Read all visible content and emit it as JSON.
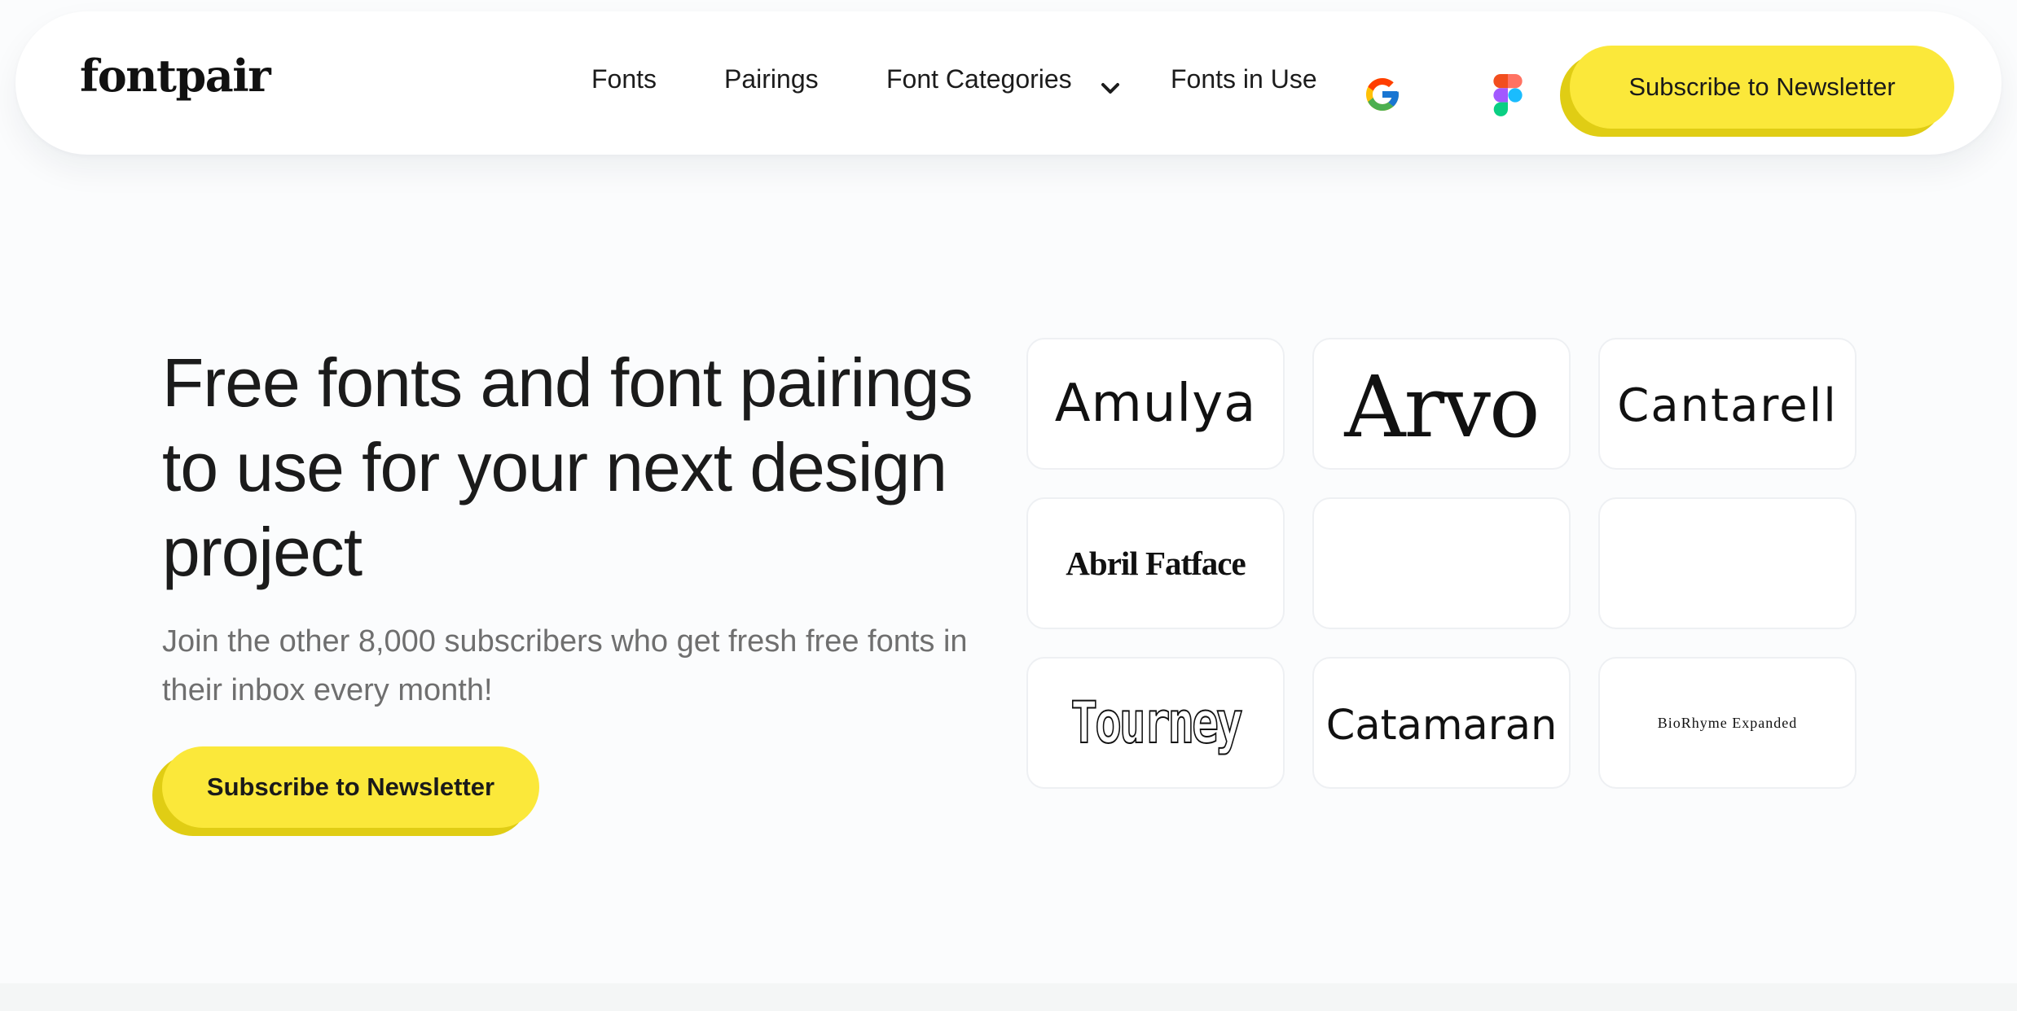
{
  "brand": {
    "logo_text": "fontpair"
  },
  "nav": {
    "links": [
      {
        "label": "Fonts"
      },
      {
        "label": "Pairings"
      },
      {
        "label": "Font Categories"
      },
      {
        "label": "Fonts in Use"
      }
    ],
    "icons": [
      "google-icon",
      "figma-icon",
      "chevron-down-icon"
    ],
    "cta_label": "Subscribe to Newsletter"
  },
  "hero": {
    "title": "Free fonts and font pairings to use for your next design project",
    "subtitle": "Join the other 8,000 subscribers who get fresh free fonts in their inbox every month!",
    "cta_label": "Subscribe to Newsletter"
  },
  "font_cards": [
    {
      "label": "Amulya"
    },
    {
      "label": "Arvo"
    },
    {
      "label": "Cantarell"
    },
    {
      "label": "Abril Fatface"
    },
    {
      "label": ""
    },
    {
      "label": ""
    },
    {
      "label": "Tourney"
    },
    {
      "label": "Catamaran"
    },
    {
      "label": "BioRhyme Expanded"
    }
  ],
  "colors": {
    "accent": "#fbe83a",
    "accent_shadow": "#e0cd14",
    "background": "#fbfcfd",
    "text": "#1b1b1b",
    "muted_text": "#6f6f6f"
  }
}
